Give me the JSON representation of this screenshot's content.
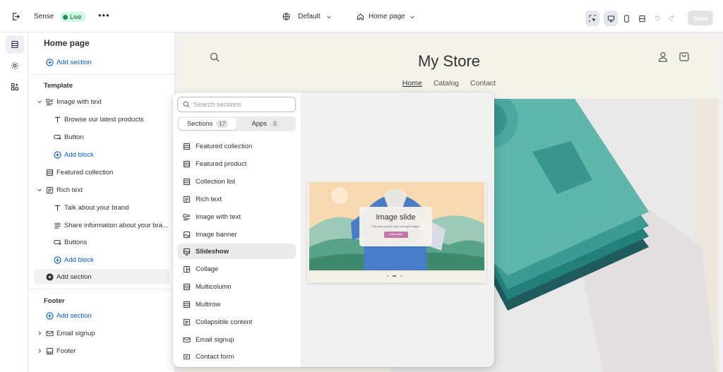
{
  "topbar": {
    "theme_name": "Sense",
    "status": "Live",
    "more": "•••",
    "theme_setting": "Default",
    "page_selector": "Home page",
    "save": "Save"
  },
  "sidebar": {
    "title": "Home page",
    "add_section": "Add section",
    "template_heading": "Template",
    "image_with_text": "Image with text",
    "browse_block": "Browse our latest products",
    "button_block": "Button",
    "add_block": "Add block",
    "featured_collection": "Featured collection",
    "rich_text": "Rich text",
    "talk_block": "Talk about your brand",
    "share_block": "Share information about your bra...",
    "buttons_block": "Buttons",
    "add_block_2": "Add block",
    "add_section_2": "Add section",
    "footer_heading": "Footer",
    "add_section_3": "Add section",
    "email_signup": "Email signup",
    "footer": "Footer"
  },
  "store": {
    "name": "My Store",
    "nav": [
      "Home",
      "Catalog",
      "Contact"
    ]
  },
  "picker": {
    "search_placeholder": "Search sections",
    "tabs": [
      {
        "label": "Sections",
        "count": "17"
      },
      {
        "label": "Apps",
        "count": "0"
      }
    ],
    "items": [
      "Featured collection",
      "Featured product",
      "Collection list",
      "Rich text",
      "Image with text",
      "Image banner",
      "Slideshow",
      "Collage",
      "Multicolumn",
      "Multirow",
      "Collapsible content",
      "Email signup",
      "Contact form"
    ],
    "preview": {
      "title": "Image slide",
      "subtitle": "Tell your brand's story through images",
      "button": "Button label"
    }
  },
  "colors": {
    "accent": "#005bd3",
    "live_bg": "#cdfee1",
    "teal": "#4aa89e",
    "dark_teal": "#1f6f6b"
  }
}
